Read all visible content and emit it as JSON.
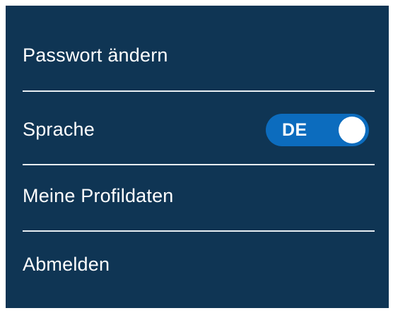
{
  "menu": {
    "password_label": "Passwort ändern",
    "language_label": "Sprache",
    "language_value": "DE",
    "language_toggle_on": true,
    "profile_label": "Meine Profildaten",
    "logout_label": "Abmelden"
  },
  "colors": {
    "panel_background": "#0f3554",
    "toggle_background": "#0c6cbe",
    "text": "#ffffff",
    "divider": "#e8eef3"
  }
}
